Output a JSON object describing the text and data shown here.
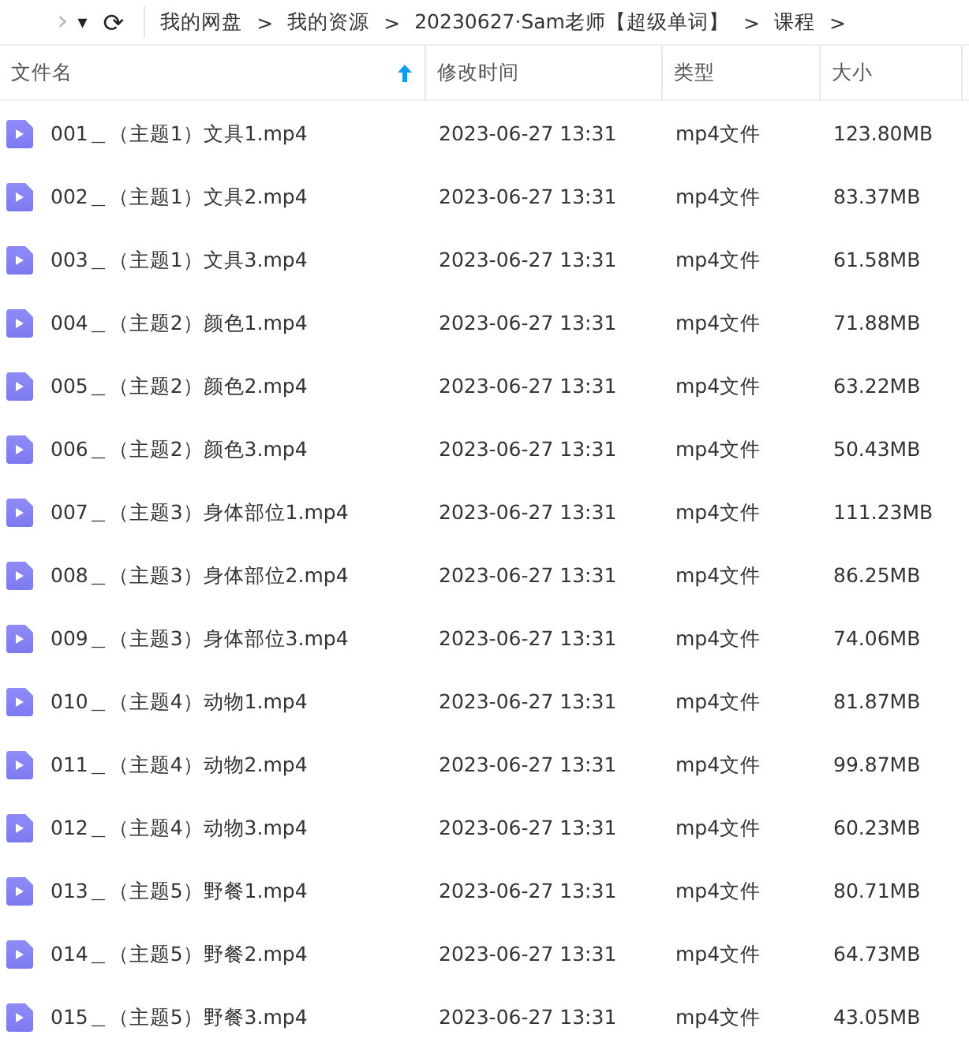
{
  "toolbar": {
    "forward_icon": "›",
    "dropdown_icon": "▾",
    "refresh_icon": "⟳"
  },
  "breadcrumb": [
    {
      "label": "我的网盘"
    },
    {
      "label": "我的资源"
    },
    {
      "label": "20230627·Sam老师【超级单词】"
    },
    {
      "label": "课程"
    }
  ],
  "breadcrumb_separator": ">",
  "table": {
    "columns": [
      {
        "label": "文件名",
        "sorted": true
      },
      {
        "label": "修改时间",
        "sorted": false
      },
      {
        "label": "类型",
        "sorted": false
      },
      {
        "label": "大小",
        "sorted": false
      }
    ],
    "rows": [
      {
        "name": "001＿（主题1）文具1.mp4",
        "modified": "2023-06-27 13:31",
        "type": "mp4文件",
        "size": "123.80MB"
      },
      {
        "name": "002＿（主题1）文具2.mp4",
        "modified": "2023-06-27 13:31",
        "type": "mp4文件",
        "size": "83.37MB"
      },
      {
        "name": "003＿（主题1）文具3.mp4",
        "modified": "2023-06-27 13:31",
        "type": "mp4文件",
        "size": "61.58MB"
      },
      {
        "name": "004＿（主题2）颜色1.mp4",
        "modified": "2023-06-27 13:31",
        "type": "mp4文件",
        "size": "71.88MB"
      },
      {
        "name": "005＿（主题2）颜色2.mp4",
        "modified": "2023-06-27 13:31",
        "type": "mp4文件",
        "size": "63.22MB"
      },
      {
        "name": "006＿（主题2）颜色3.mp4",
        "modified": "2023-06-27 13:31",
        "type": "mp4文件",
        "size": "50.43MB"
      },
      {
        "name": "007＿（主题3）身体部位1.mp4",
        "modified": "2023-06-27 13:31",
        "type": "mp4文件",
        "size": "111.23MB"
      },
      {
        "name": "008＿（主题3）身体部位2.mp4",
        "modified": "2023-06-27 13:31",
        "type": "mp4文件",
        "size": "86.25MB"
      },
      {
        "name": "009＿（主题3）身体部位3.mp4",
        "modified": "2023-06-27 13:31",
        "type": "mp4文件",
        "size": "74.06MB"
      },
      {
        "name": "010＿（主题4）动物1.mp4",
        "modified": "2023-06-27 13:31",
        "type": "mp4文件",
        "size": "81.87MB"
      },
      {
        "name": "011＿（主题4）动物2.mp4",
        "modified": "2023-06-27 13:31",
        "type": "mp4文件",
        "size": "99.87MB"
      },
      {
        "name": "012＿（主题4）动物3.mp4",
        "modified": "2023-06-27 13:31",
        "type": "mp4文件",
        "size": "60.23MB"
      },
      {
        "name": "013＿（主题5）野餐1.mp4",
        "modified": "2023-06-27 13:31",
        "type": "mp4文件",
        "size": "80.71MB"
      },
      {
        "name": "014＿（主题5）野餐2.mp4",
        "modified": "2023-06-27 13:31",
        "type": "mp4文件",
        "size": "64.73MB"
      },
      {
        "name": "015＿（主题5）野餐3.mp4",
        "modified": "2023-06-27 13:31",
        "type": "mp4文件",
        "size": "43.05MB"
      }
    ]
  }
}
